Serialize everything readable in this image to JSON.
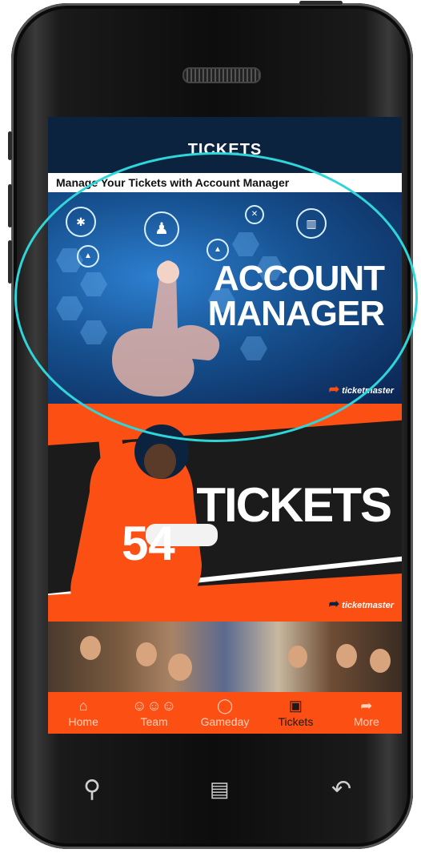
{
  "header": {
    "title": "TICKETS"
  },
  "promo": {
    "text": "Manage Your Tickets with Account Manager"
  },
  "account_banner": {
    "line1": "ACCOUNT",
    "line2": "MANAGER",
    "brand": "ticketmaster"
  },
  "tickets_banner": {
    "text": "TICKETS",
    "jersey_number": "54",
    "brand": "ticketmaster"
  },
  "tabs": [
    {
      "label": "Home",
      "icon": "home-icon"
    },
    {
      "label": "Team",
      "icon": "team-icon"
    },
    {
      "label": "Gameday",
      "icon": "gameday-icon"
    },
    {
      "label": "Tickets",
      "icon": "tickets-icon",
      "active": true
    },
    {
      "label": "More",
      "icon": "more-icon"
    }
  ],
  "colors": {
    "navy": "#0c2340",
    "orange": "#fb4f14",
    "highlight": "#2fd6d9"
  }
}
